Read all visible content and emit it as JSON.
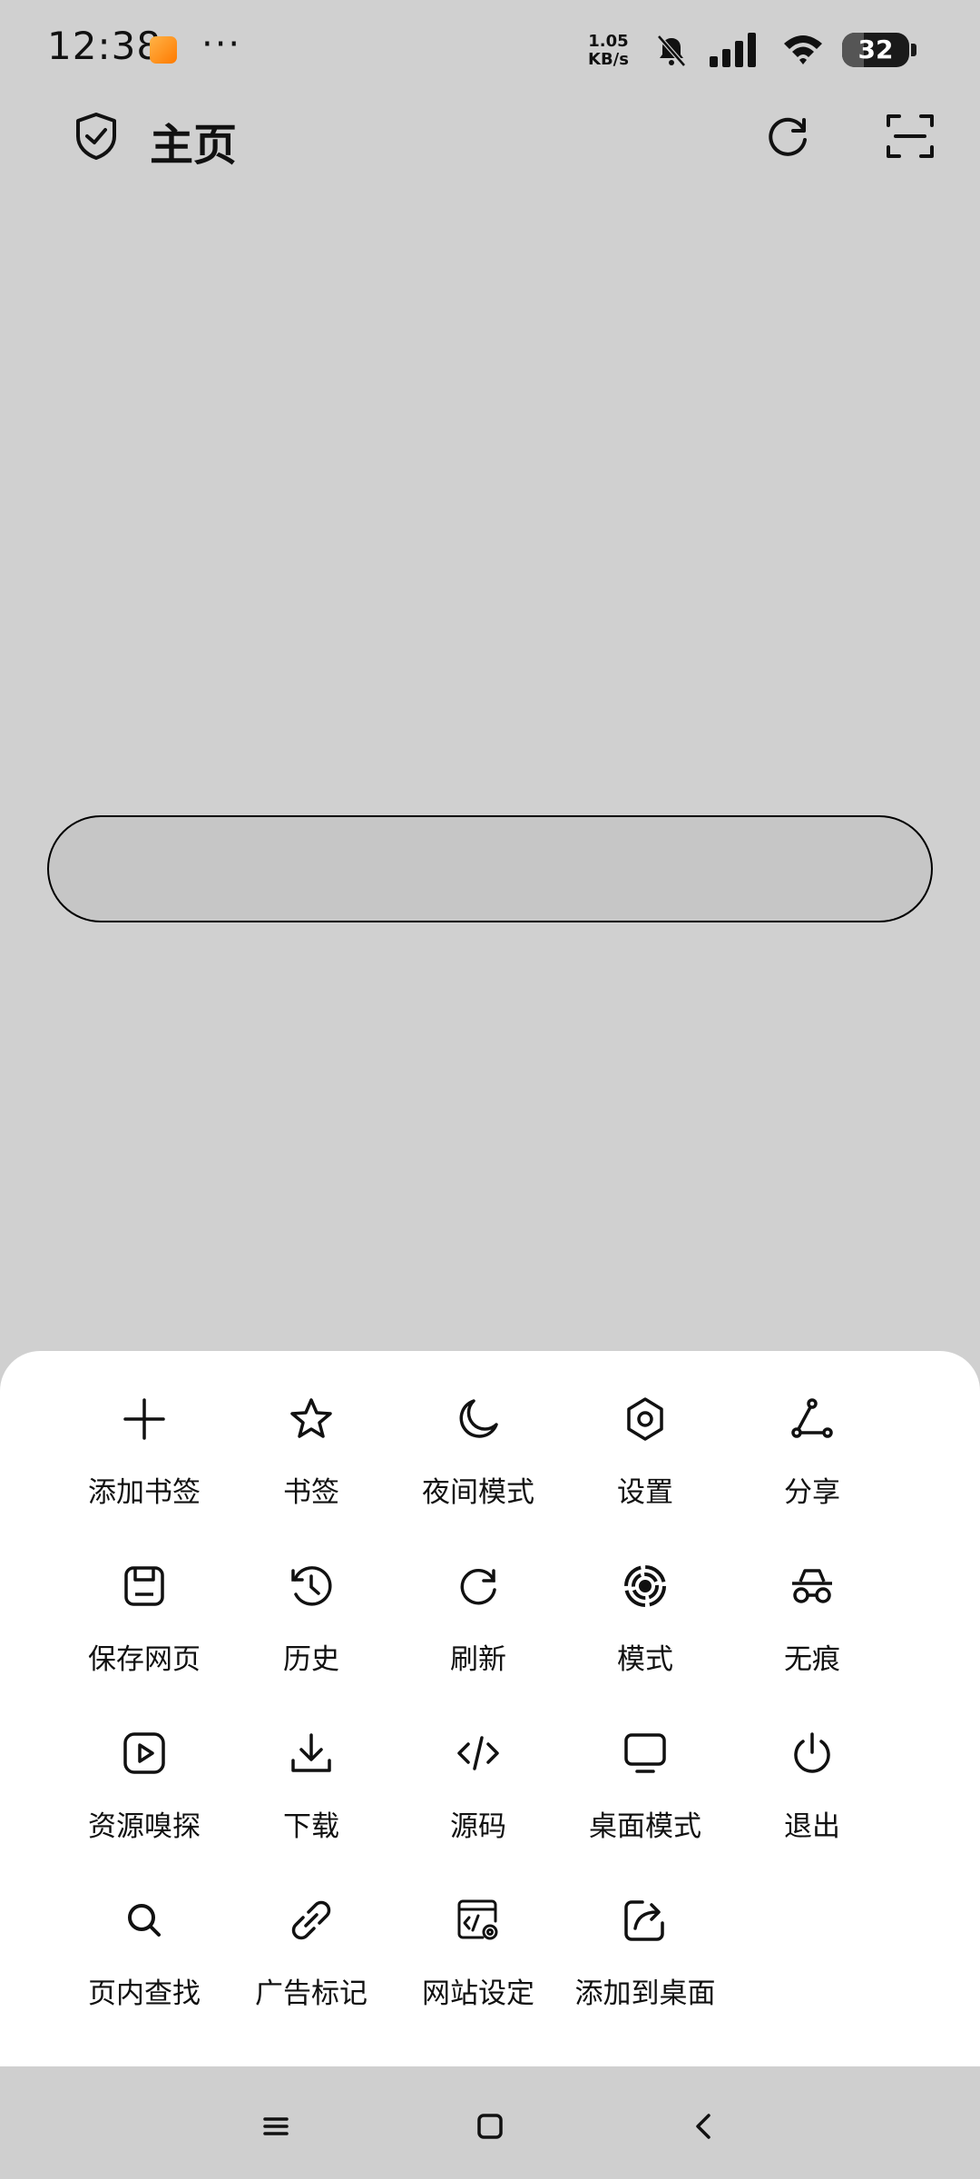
{
  "status_bar": {
    "time": "12:38",
    "more": "···",
    "net_speed_value": "1.05",
    "net_speed_unit": "KB/s",
    "battery_level": "32",
    "icons": [
      "app-notification-icon",
      "bell-off-icon",
      "signal-icon",
      "wifi-icon",
      "battery-icon"
    ]
  },
  "header": {
    "title": "主页",
    "icons": [
      "shield-check-icon",
      "refresh-icon",
      "scan-icon"
    ]
  },
  "search": {
    "value": ""
  },
  "menu": {
    "items": [
      {
        "label": "添加书签",
        "icon": "plus-icon"
      },
      {
        "label": "书签",
        "icon": "star-icon"
      },
      {
        "label": "夜间模式",
        "icon": "moon-icon"
      },
      {
        "label": "设置",
        "icon": "gear-icon"
      },
      {
        "label": "分享",
        "icon": "share-icon"
      },
      {
        "label": "保存网页",
        "icon": "save-icon"
      },
      {
        "label": "历史",
        "icon": "history-icon"
      },
      {
        "label": "刷新",
        "icon": "refresh-icon"
      },
      {
        "label": "模式",
        "icon": "mode-icon"
      },
      {
        "label": "无痕",
        "icon": "incognito-icon"
      },
      {
        "label": "资源嗅探",
        "icon": "play-icon"
      },
      {
        "label": "下载",
        "icon": "download-icon"
      },
      {
        "label": "源码",
        "icon": "code-icon"
      },
      {
        "label": "桌面模式",
        "icon": "monitor-icon"
      },
      {
        "label": "退出",
        "icon": "power-icon"
      },
      {
        "label": "页内查找",
        "icon": "search-icon"
      },
      {
        "label": "广告标记",
        "icon": "link-icon"
      },
      {
        "label": "网站设定",
        "icon": "site-settings-icon"
      },
      {
        "label": "添加到桌面",
        "icon": "add-to-desktop-icon"
      }
    ]
  },
  "nav_bar": {
    "icons": [
      "menu-icon",
      "home-icon",
      "back-icon"
    ]
  },
  "colors": {
    "background": "#d0d0d0",
    "sheet": "#ffffff",
    "text": "#111111"
  }
}
